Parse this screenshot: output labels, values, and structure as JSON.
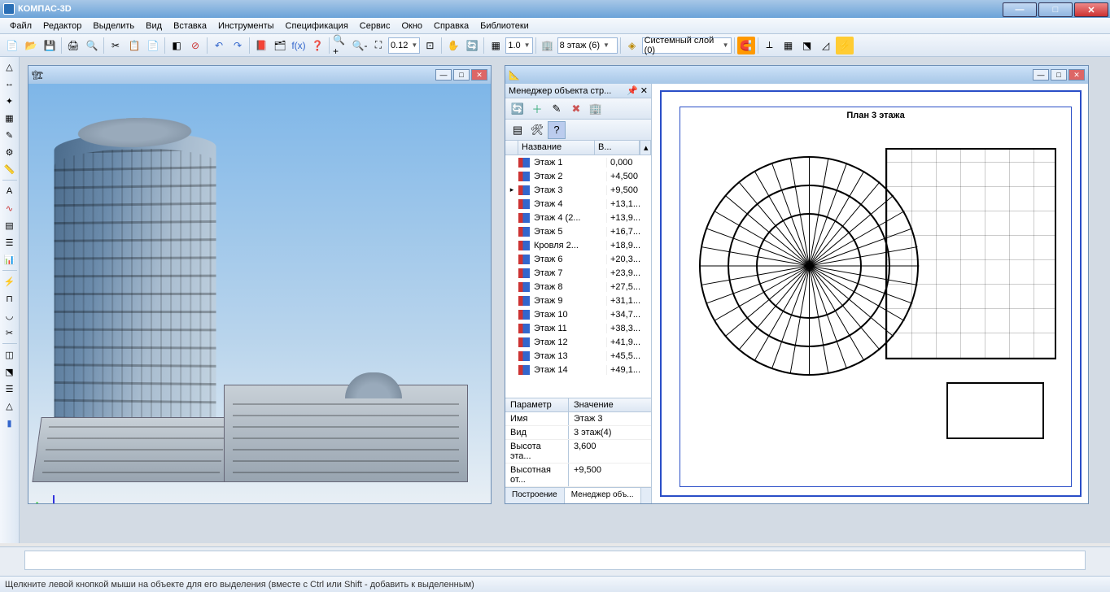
{
  "app": {
    "title": "КОМПАС-3D"
  },
  "menu": [
    "Файл",
    "Редактор",
    "Выделить",
    "Вид",
    "Вставка",
    "Инструменты",
    "Спецификация",
    "Сервис",
    "Окно",
    "Справка",
    "Библиотеки"
  ],
  "toolbar": {
    "zoom_value": "0.12",
    "scale_value": "1.0",
    "floor_combo": "8 этаж (6)",
    "layer_combo": "Системный слой (0)"
  },
  "manager": {
    "title": "Менеджер объекта стр...",
    "col_name": "Название",
    "col_val": "В...",
    "floors": [
      {
        "name": "Этаж 1",
        "val": "0,000",
        "sel": false
      },
      {
        "name": "Этаж 2",
        "val": "+4,500",
        "sel": false
      },
      {
        "name": "Этаж 3",
        "val": "+9,500",
        "sel": true
      },
      {
        "name": "Этаж 4",
        "val": "+13,1...",
        "sel": false
      },
      {
        "name": "Этаж 4 (2...",
        "val": "+13,9...",
        "sel": false
      },
      {
        "name": "Этаж 5",
        "val": "+16,7...",
        "sel": false
      },
      {
        "name": "Кровля 2...",
        "val": "+18,9...",
        "sel": false
      },
      {
        "name": "Этаж 6",
        "val": "+20,3...",
        "sel": false
      },
      {
        "name": "Этаж 7",
        "val": "+23,9...",
        "sel": false
      },
      {
        "name": "Этаж 8",
        "val": "+27,5...",
        "sel": false
      },
      {
        "name": "Этаж 9",
        "val": "+31,1...",
        "sel": false
      },
      {
        "name": "Этаж 10",
        "val": "+34,7...",
        "sel": false
      },
      {
        "name": "Этаж 11",
        "val": "+38,3...",
        "sel": false
      },
      {
        "name": "Этаж 12",
        "val": "+41,9...",
        "sel": false
      },
      {
        "name": "Этаж 13",
        "val": "+45,5...",
        "sel": false
      },
      {
        "name": "Этаж 14",
        "val": "+49,1...",
        "sel": false
      }
    ],
    "param_header": {
      "p": "Параметр",
      "v": "Значение"
    },
    "params": [
      {
        "p": "Имя",
        "v": "Этаж 3"
      },
      {
        "p": "Вид",
        "v": "3 этаж(4)"
      },
      {
        "p": "Высота эта...",
        "v": "3,600"
      },
      {
        "p": "Высотная от...",
        "v": "+9,500"
      }
    ],
    "tabs": {
      "a": "Построение",
      "b": "Менеджер объ..."
    }
  },
  "drawing": {
    "title": "План 3 этажа"
  },
  "status": "Щелкните левой кнопкой мыши на объекте для его выделения (вместе с Ctrl или Shift - добавить к выделенным)"
}
